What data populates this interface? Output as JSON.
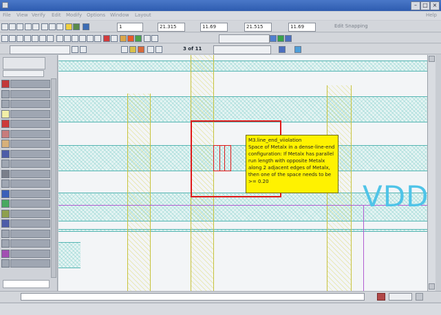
{
  "menubar": {
    "items": [
      "File",
      "View",
      "Verify",
      "Edit",
      "Modify",
      "Options",
      "Window",
      "Layout",
      "Help"
    ],
    "help_label": "Help"
  },
  "toolbar_coords": {
    "zoom_field": "1",
    "x1": "21.315",
    "y1": "11.69",
    "x2": "21.515",
    "y2": "11.69",
    "snap_label": "Edit Snapping"
  },
  "toolbar_view": {
    "result_counter": "3 of 11"
  },
  "tooltip": {
    "rule_name": "M3.line_end_viiolation",
    "lines": [
      "Space of Metalx in a dense-line-end",
      "configuration: If Metalx has parallel",
      "run length with opposite Metalx",
      "along 2 adjacent edges of Metalx,",
      "then one of the space needs to be",
      ">= 0.20"
    ]
  },
  "canvas": {
    "net_label": "VDD"
  },
  "colors": {
    "metal_band": "#54b5b2",
    "poly_column": "#c7c23c",
    "violation_box": "#e01818",
    "tooltip_bg": "#fff200",
    "net_text": "#4fc4e8"
  },
  "layers": [
    {
      "swatch": "#c23a3a"
    },
    {
      "swatch": "#9fa6b2"
    },
    {
      "swatch": "#9fa6b2"
    },
    {
      "swatch": "#f1eea7"
    },
    {
      "swatch": "#cc3a3a"
    },
    {
      "swatch": "#c77c7c"
    },
    {
      "swatch": "#d6b07a"
    },
    {
      "swatch": "#4d5ca8"
    },
    {
      "swatch": "#9fa6b2"
    },
    {
      "swatch": "#7a7f8a"
    },
    {
      "swatch": "#9fa6b2"
    },
    {
      "swatch": "#3b5fb8"
    },
    {
      "swatch": "#48a860"
    },
    {
      "swatch": "#8ea04e"
    },
    {
      "swatch": "#4d5ca8"
    },
    {
      "swatch": "#9fa6b2"
    },
    {
      "swatch": "#9fa6b2"
    },
    {
      "swatch": "#a24fb2"
    },
    {
      "swatch": "#9fa6b2"
    }
  ]
}
